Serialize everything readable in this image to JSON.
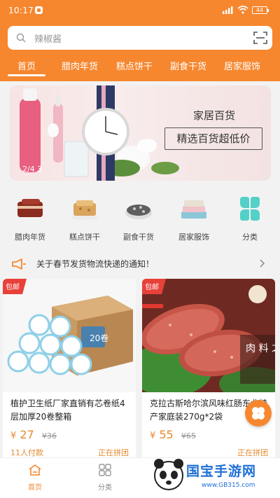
{
  "status_bar": {
    "time": "10:17",
    "battery": "44"
  },
  "search": {
    "placeholder": "辣椒酱"
  },
  "tabs": [
    {
      "label": "首页"
    },
    {
      "label": "腊肉年货"
    },
    {
      "label": "糕点饼干"
    },
    {
      "label": "副食干货"
    },
    {
      "label": "居家服饰"
    }
  ],
  "banner": {
    "title": "家居百货",
    "subtitle": "精选百货超低价",
    "page": "2/4 3"
  },
  "categories": [
    {
      "label": "腊肉年货",
      "icon": "bacon-icon"
    },
    {
      "label": "糕点饼干",
      "icon": "biscuit-icon"
    },
    {
      "label": "副食干货",
      "icon": "dried-goods-icon"
    },
    {
      "label": "居家服饰",
      "icon": "clothing-icon"
    },
    {
      "label": "分类",
      "icon": "category-clover-icon"
    }
  ],
  "notice": {
    "text": "关于春节发货物流快递的通知！"
  },
  "products": [
    {
      "badge": "包邮",
      "box_label": "20卷",
      "title": "植护卫生纸厂家直销有芯卷纸4层加厚20卷整箱",
      "currency": "¥",
      "price": "27",
      "old_price": "¥36",
      "paid": "11人付款",
      "tag": "正在拼团"
    },
    {
      "badge": "包邮",
      "overlay_text": "肉 料 之",
      "title": "克拉古斯哈尔滨风味红肠东北特产家庭装270g*2袋",
      "currency": "¥",
      "price": "55",
      "old_price": "¥65",
      "paid": "",
      "tag": "正在拼团"
    }
  ],
  "bottom_nav": [
    {
      "label": "首页",
      "icon": "home-icon",
      "active": true
    },
    {
      "label": "分类",
      "icon": "grid-icon",
      "active": false
    }
  ],
  "watermark": {
    "name": "国宝手游网",
    "url": "www.GB315.com"
  },
  "colors": {
    "accent": "#f6872f",
    "price": "#e58a2e"
  }
}
